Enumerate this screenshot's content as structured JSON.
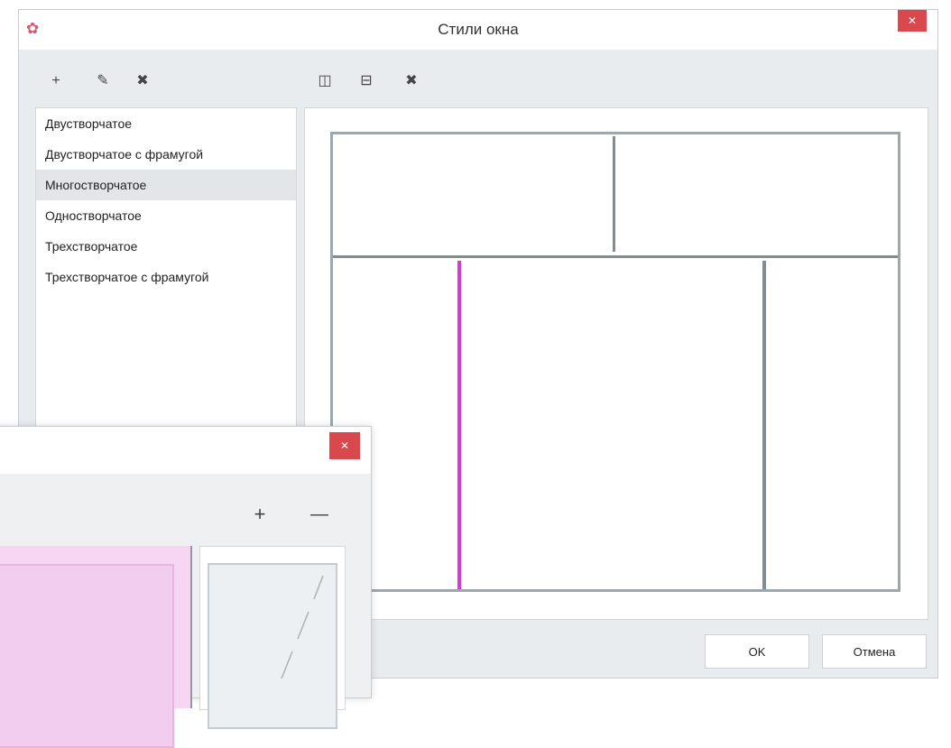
{
  "main_window": {
    "title": "Стили окна",
    "close_glyph": "✕",
    "toolbar_left": [
      {
        "name": "add-icon",
        "glyph": "+"
      },
      {
        "name": "edit-icon",
        "glyph": "✎"
      },
      {
        "name": "delete-icon",
        "glyph": "✖"
      }
    ],
    "toolbar_right": [
      {
        "name": "split-vertical-icon",
        "glyph": "◫"
      },
      {
        "name": "split-horizontal-icon",
        "glyph": "⊟"
      },
      {
        "name": "remove-split-icon",
        "glyph": "✖"
      }
    ],
    "styles": [
      {
        "label": "Двустворчатое",
        "selected": false
      },
      {
        "label": "Двустворчатое с фрамугой",
        "selected": false
      },
      {
        "label": "Многостворчатое",
        "selected": true
      },
      {
        "label": "Одностворчатое",
        "selected": false
      },
      {
        "label": "Трехстворчатое",
        "selected": false
      },
      {
        "label": "Трехстворчатое с фрамугой",
        "selected": false
      }
    ],
    "ok_label": "OK",
    "cancel_label": "Отмена",
    "selected_mullion_color": "#d63ad6",
    "mullion_color": "#7e8d96",
    "close_color": "#d9484d"
  },
  "second_window": {
    "close_glyph": "✕",
    "zoom_in_glyph": "+",
    "zoom_out_glyph": "—"
  }
}
